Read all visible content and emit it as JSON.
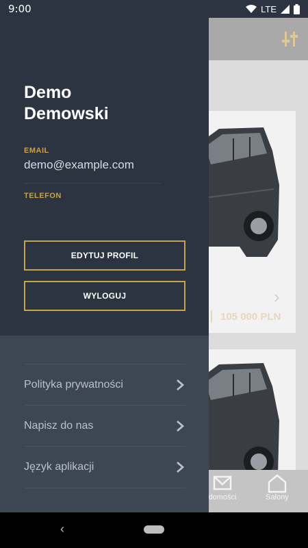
{
  "status_bar": {
    "time": "9:00",
    "network": "LTE",
    "icons": [
      "wifi-icon",
      "signal-icon",
      "battery-icon"
    ]
  },
  "background": {
    "listing": {
      "price": "105 000 PLN"
    },
    "bottom_nav": {
      "messages_label": "domości",
      "salony_label": "Salony"
    }
  },
  "drawer": {
    "user": {
      "first_name": "Demo",
      "last_name": "Demowski"
    },
    "email_label": "EMAIL",
    "email_value": "demo@example.com",
    "phone_label": "TELEFON",
    "phone_value": "",
    "buttons": {
      "edit_profile": "EDYTUJ PROFIL",
      "logout": "WYLOGUJ"
    },
    "menu": [
      {
        "label": "Polityka prywatności"
      },
      {
        "label": "Napisz do nas"
      },
      {
        "label": "Język aplikacji"
      }
    ]
  },
  "colors": {
    "accent": "#c9a24b",
    "drawer_top": "#2b3440",
    "drawer_bottom": "#3d4753"
  }
}
